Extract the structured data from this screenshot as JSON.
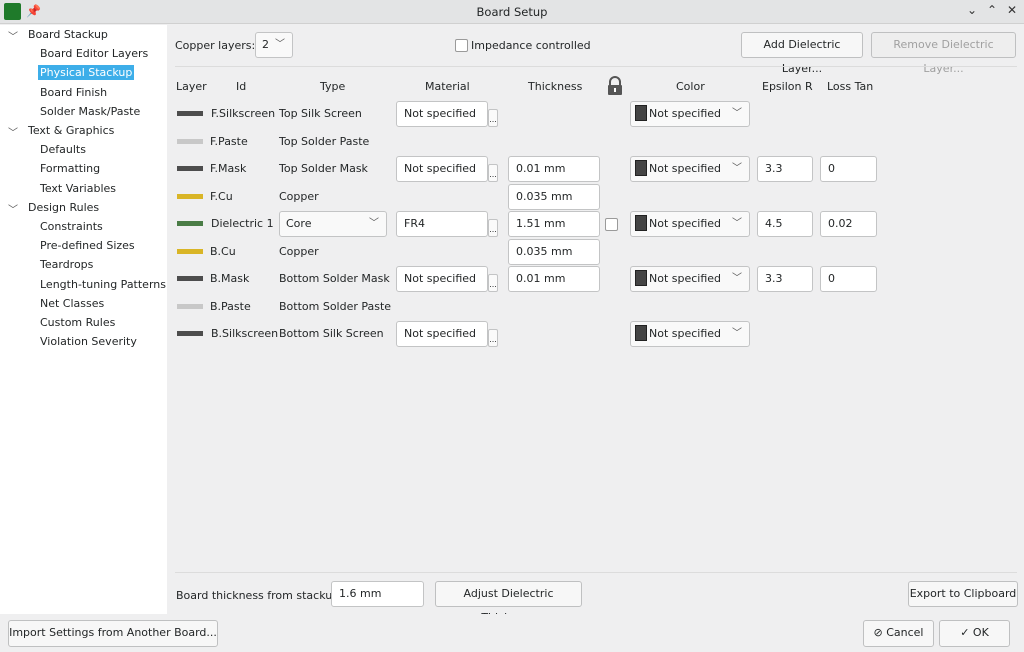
{
  "window": {
    "title": "Board Setup",
    "icon": "kicad-pcb-icon",
    "pin_icon": "pin-icon",
    "controls": [
      "minimize",
      "maximize",
      "close"
    ]
  },
  "sidebar": {
    "items": [
      {
        "label": "Board Stackup",
        "level": 0,
        "expanded": true
      },
      {
        "label": "Board Editor Layers",
        "level": 1
      },
      {
        "label": "Physical Stackup",
        "level": 1,
        "selected": true
      },
      {
        "label": "Board Finish",
        "level": 1
      },
      {
        "label": "Solder Mask/Paste",
        "level": 1
      },
      {
        "label": "Text & Graphics",
        "level": 0,
        "expanded": true
      },
      {
        "label": "Defaults",
        "level": 1
      },
      {
        "label": "Formatting",
        "level": 1
      },
      {
        "label": "Text Variables",
        "level": 1
      },
      {
        "label": "Design Rules",
        "level": 0,
        "expanded": true
      },
      {
        "label": "Constraints",
        "level": 1
      },
      {
        "label": "Pre-defined Sizes",
        "level": 1
      },
      {
        "label": "Teardrops",
        "level": 1
      },
      {
        "label": "Length-tuning Patterns",
        "level": 1
      },
      {
        "label": "Net Classes",
        "level": 1
      },
      {
        "label": "Custom Rules",
        "level": 1
      },
      {
        "label": "Violation Severity",
        "level": 1
      }
    ]
  },
  "toolbar": {
    "copper_layers_label": "Copper layers:",
    "copper_layers_value": "2",
    "impedance_label": "Impedance controlled",
    "impedance_checked": false,
    "add_dielectric": "Add Dielectric Layer...",
    "remove_dielectric": "Remove Dielectric Layer..."
  },
  "columns": {
    "layer": "Layer",
    "id": "Id",
    "type": "Type",
    "material": "Material",
    "thickness": "Thickness",
    "color": "Color",
    "epsilon": "Epsilon R",
    "loss": "Loss Tan"
  },
  "layers": [
    {
      "id": "F.Silkscreen",
      "swatch": "#4d4d4d",
      "type": "Top Silk Screen",
      "material": "Not specified",
      "color": "Not specified"
    },
    {
      "id": "F.Paste",
      "swatch": "#c8c8c8",
      "type": "Top Solder Paste"
    },
    {
      "id": "F.Mask",
      "swatch": "#4d4d4d",
      "type": "Top Solder Mask",
      "material": "Not specified",
      "thickness": "0.01 mm",
      "color": "Not specified",
      "epsilon": "3.3",
      "loss": "0"
    },
    {
      "id": "F.Cu",
      "swatch": "#d9b526",
      "type": "Copper",
      "thickness": "0.035 mm"
    },
    {
      "id": "Dielectric 1",
      "swatch": "#4a7c46",
      "type": "Core",
      "type_combo": true,
      "material": "FR4",
      "thickness": "1.51 mm",
      "lock": false,
      "color": "Not specified",
      "epsilon": "4.5",
      "loss": "0.02"
    },
    {
      "id": "B.Cu",
      "swatch": "#d9b526",
      "type": "Copper",
      "thickness": "0.035 mm"
    },
    {
      "id": "B.Mask",
      "swatch": "#4d4d4d",
      "type": "Bottom Solder Mask",
      "material": "Not specified",
      "thickness": "0.01 mm",
      "color": "Not specified",
      "epsilon": "3.3",
      "loss": "0"
    },
    {
      "id": "B.Paste",
      "swatch": "#c8c8c8",
      "type": "Bottom Solder Paste"
    },
    {
      "id": "B.Silkscreen",
      "swatch": "#4d4d4d",
      "type": "Bottom Silk Screen",
      "material": "Not specified",
      "color": "Not specified"
    }
  ],
  "footer": {
    "board_thickness_label": "Board thickness from stackup:",
    "board_thickness_value": "1.6 mm",
    "adjust": "Adjust Dielectric Thickness",
    "export": "Export to Clipboard"
  },
  "dialog": {
    "import": "Import Settings from Another Board...",
    "cancel": "Cancel",
    "ok": "OK"
  },
  "colors": {
    "selection": "#3daee9"
  }
}
